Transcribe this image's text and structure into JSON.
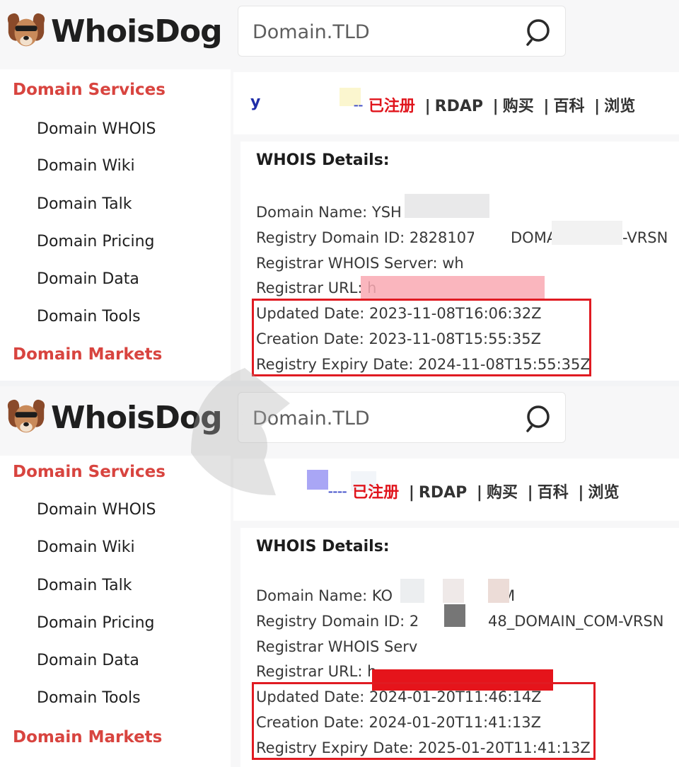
{
  "colors": {
    "accent_red": "#d8443f",
    "status_red": "#e0141c",
    "highlight_border": "#e01b22",
    "link_blue": "#1f2da8"
  },
  "panels": [
    {
      "logo": {
        "text": "WhoisDog",
        "icon": "dog-logo-icon"
      },
      "search": {
        "placeholder": "Domain.TLD",
        "icon": "search-icon"
      },
      "sidebar": {
        "heading_services": "Domain Services",
        "items": [
          "Domain WHOIS",
          "Domain Wiki",
          "Domain Talk",
          "Domain Pricing",
          "Domain Data",
          "Domain Tools"
        ],
        "heading_markets": "Domain Markets"
      },
      "domain_bar": {
        "domain_fragment": "y",
        "status": "已注册",
        "links": [
          "RDAP",
          "购买",
          "百科",
          "浏览"
        ]
      },
      "details": {
        "title": "WHOIS Details:",
        "lines": [
          "Domain Name: YSH",
          "Registry Domain ID: 28281073",
          "Registrar WHOIS Server: wh",
          "Registrar URL: h",
          "Updated Date: 2023-11-08T16:06:32Z",
          "Creation Date: 2023-11-08T15:55:35Z",
          "Registry Expiry Date: 2024-11-08T15:55:35Z"
        ],
        "line_suffix_1": "DOMA",
        "line_suffix_2": "-VRSN"
      }
    },
    {
      "logo": {
        "text": "WhoisDog",
        "icon": "dog-logo-icon"
      },
      "search": {
        "placeholder": "Domain.TLD",
        "icon": "search-icon"
      },
      "sidebar": {
        "heading_services": "Domain Services",
        "items": [
          "Domain WHOIS",
          "Domain Wiki",
          "Domain Talk",
          "Domain Pricing",
          "Domain Data",
          "Domain Tools"
        ],
        "heading_markets": "Domain Markets"
      },
      "domain_bar": {
        "domain_fragment": "",
        "status": "已注册",
        "links": [
          "RDAP",
          "购买",
          "百科",
          "浏览"
        ]
      },
      "details": {
        "title": "WHOIS Details:",
        "lines": [
          "Domain Name: KO",
          "Registry Domain ID: 2",
          "Registrar WHOIS Serv",
          "Registrar URL: h",
          "Updated Date: 2024-01-20T11:46:14Z",
          "Creation Date: 2024-01-20T11:41:13Z",
          "Registry Expiry Date: 2025-01-20T11:41:13Z"
        ],
        "line_suffix_1": "48_DOMAIN_COM-VRSN",
        "line_suffix_2": "M"
      }
    }
  ]
}
